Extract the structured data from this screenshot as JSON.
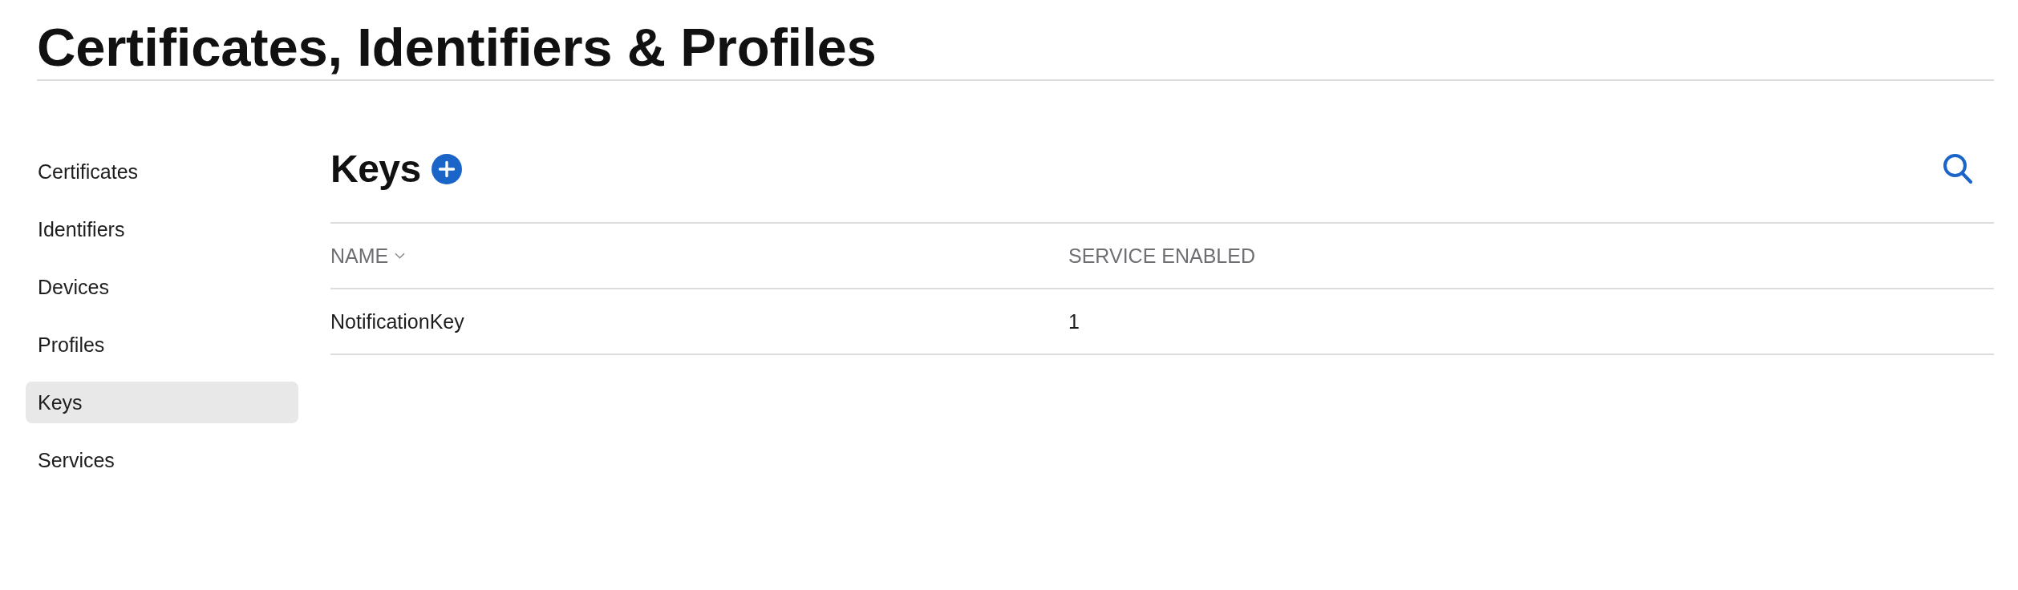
{
  "page": {
    "title": "Certificates, Identifiers & Profiles"
  },
  "sidebar": {
    "items": [
      {
        "label": "Certificates",
        "selected": false
      },
      {
        "label": "Identifiers",
        "selected": false
      },
      {
        "label": "Devices",
        "selected": false
      },
      {
        "label": "Profiles",
        "selected": false
      },
      {
        "label": "Keys",
        "selected": true
      },
      {
        "label": "Services",
        "selected": false
      }
    ]
  },
  "section": {
    "title": "Keys"
  },
  "table": {
    "columns": [
      {
        "label": "NAME",
        "sorted": true
      },
      {
        "label": "SERVICE ENABLED",
        "sorted": false
      }
    ],
    "rows": [
      {
        "cells": [
          "NotificationKey",
          "1"
        ]
      }
    ]
  }
}
